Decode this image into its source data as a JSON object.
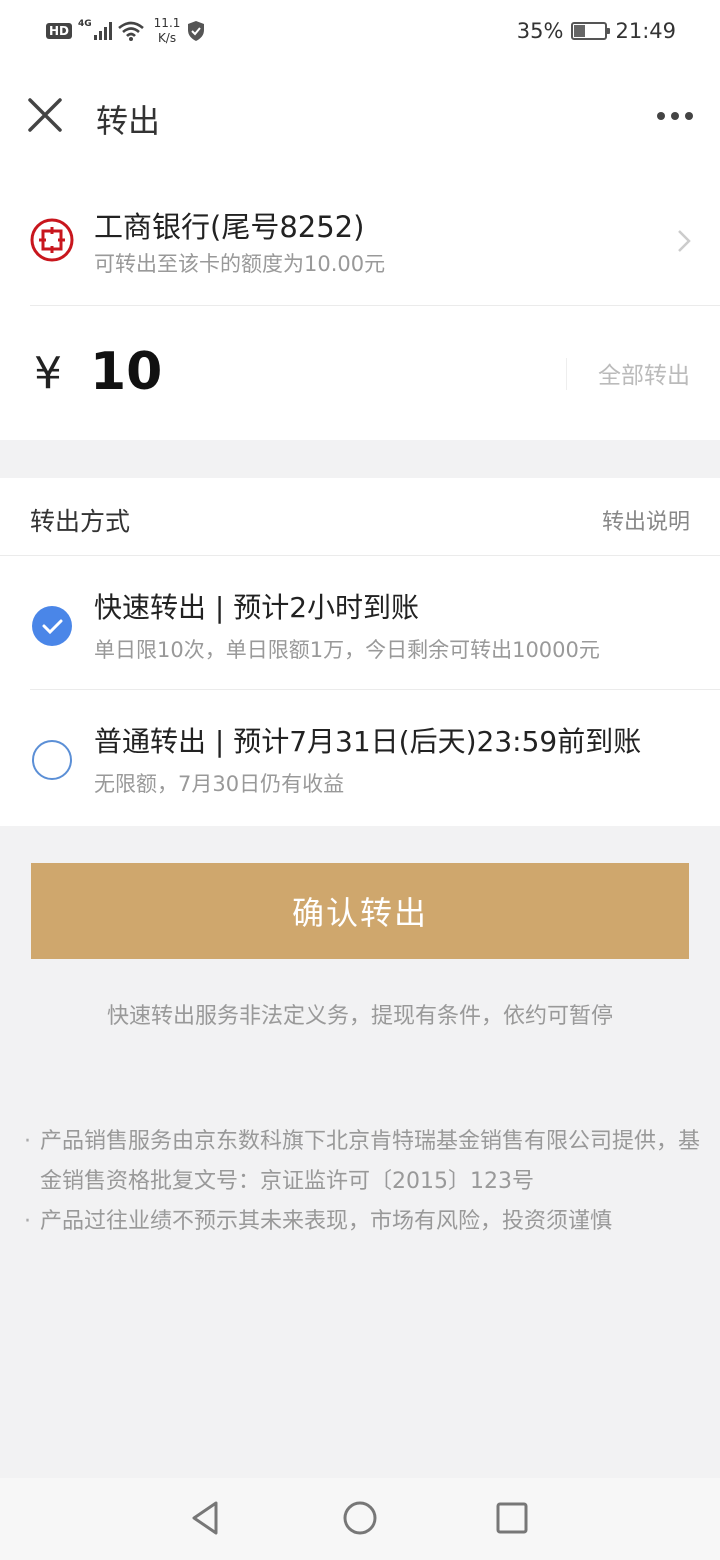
{
  "status_bar": {
    "hd": "HD",
    "network": "4G",
    "speed_value": "11.1",
    "speed_unit": "K/s",
    "battery_percent": "35%",
    "battery_level": 0.35,
    "time": "21:49"
  },
  "nav": {
    "title": "转出",
    "close_icon": "close-icon",
    "more_icon": "more-icon"
  },
  "bank": {
    "name": "工商银行(尾号8252)",
    "limit_text": "可转出至该卡的额度为10.00元",
    "logo_color": "#c8161d"
  },
  "amount": {
    "currency": "¥",
    "value": "10",
    "withdraw_all": "全部转出"
  },
  "method": {
    "title": "转出方式",
    "help": "转出说明",
    "options": [
      {
        "title": "快速转出 | 预计2小时到账",
        "subtitle": "单日限10次，单日限额1万，今日剩余可转出10000元",
        "selected": true
      },
      {
        "title": "普通转出 | 预计7月31日(后天)23:59前到账",
        "subtitle": "无限额，7月30日仍有收益",
        "selected": false
      }
    ]
  },
  "confirm": {
    "label": "确认转出",
    "note": "快速转出服务非法定义务，提现有条件，依约可暂停",
    "color": "#cfa76d"
  },
  "disclaimer": [
    "产品销售服务由京东数科旗下北京肯特瑞基金销售有限公司提供，基金销售资格批复文号：京证监许可〔2015〕123号",
    "产品过往业绩不预示其未来表现，市场有风险，投资须谨慎"
  ],
  "accent_color": "#4a86e8"
}
